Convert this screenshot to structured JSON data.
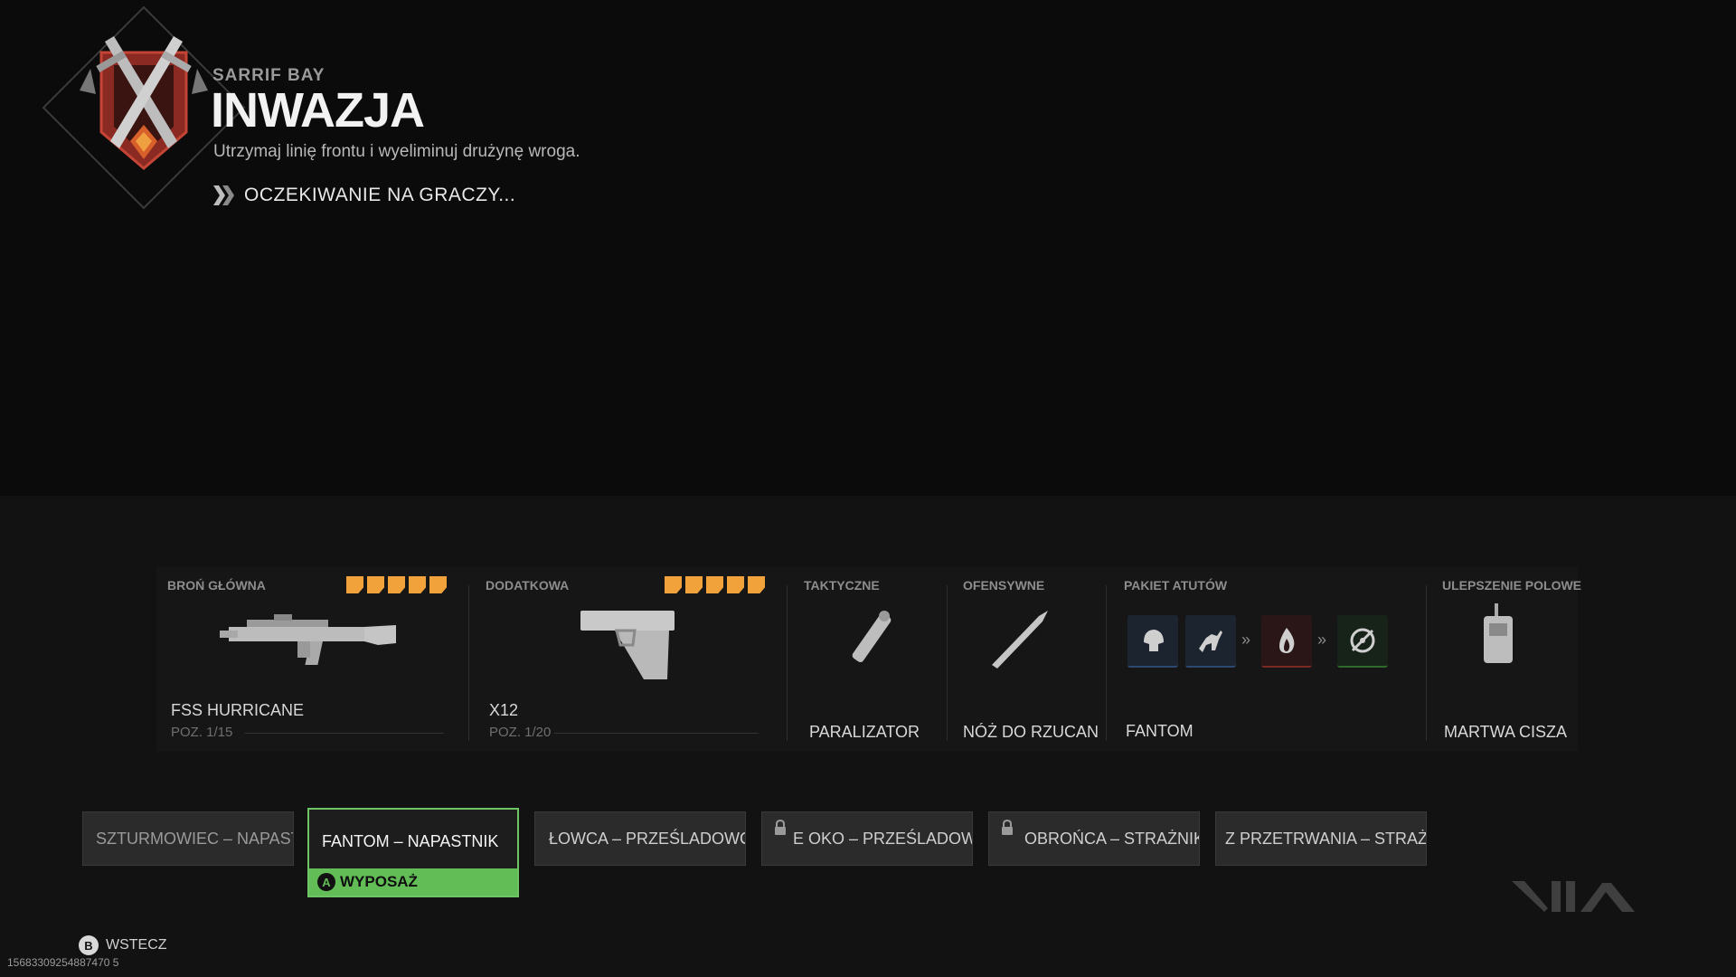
{
  "header": {
    "map_name": "SARRIF BAY",
    "mode_title": "INWAZJA",
    "mode_description": "Utrzymaj linię frontu i wyeliminuj drużynę wroga.",
    "status": "OCZEKIWANIE NA GRACZY..."
  },
  "loadout": {
    "primary": {
      "header": "BROŃ GŁÓWNA",
      "name": "FSS HURRICANE",
      "level": "POZ. 1/15",
      "stars": 5,
      "level_fraction": 0.067
    },
    "secondary": {
      "header": "DODATKOWA",
      "name": "X12",
      "level": "POZ. 1/20",
      "stars": 5,
      "level_fraction": 0.05
    },
    "tactical": {
      "header": "TAKTYCZNE",
      "name": "PARALIZATOR"
    },
    "lethal": {
      "header": "OFENSYWNE",
      "name": "NÓŻ DO RZUCANIA"
    },
    "perks": {
      "header": "PAKIET ATUTÓW",
      "name": "FANTOM"
    },
    "field_upgrade": {
      "header": "ULEPSZENIE POLOWE",
      "name": "MARTWA CISZA"
    }
  },
  "classes": [
    {
      "label": "SZTURMOWIEC – NAPASTNIK"
    },
    {
      "label": "FANTOM – NAPASTNIK",
      "action": "WYPOSAŻ",
      "action_button": "A"
    },
    {
      "label": "ŁOWCA – PRZEŚLADOWCA"
    },
    {
      "label": "E OKO – PRZEŚLADOWCA"
    },
    {
      "label": "OBROŃCA – STRAŻNIK"
    },
    {
      "label": "Z PRZETRWANIA – STRAŻNIK"
    }
  ],
  "footer": {
    "back_button": "B",
    "back_label": "WSTECZ",
    "session_id": "15683309254887470 5"
  },
  "colors": {
    "accent_green": "#62bd56",
    "star_orange": "#f2a23a"
  }
}
